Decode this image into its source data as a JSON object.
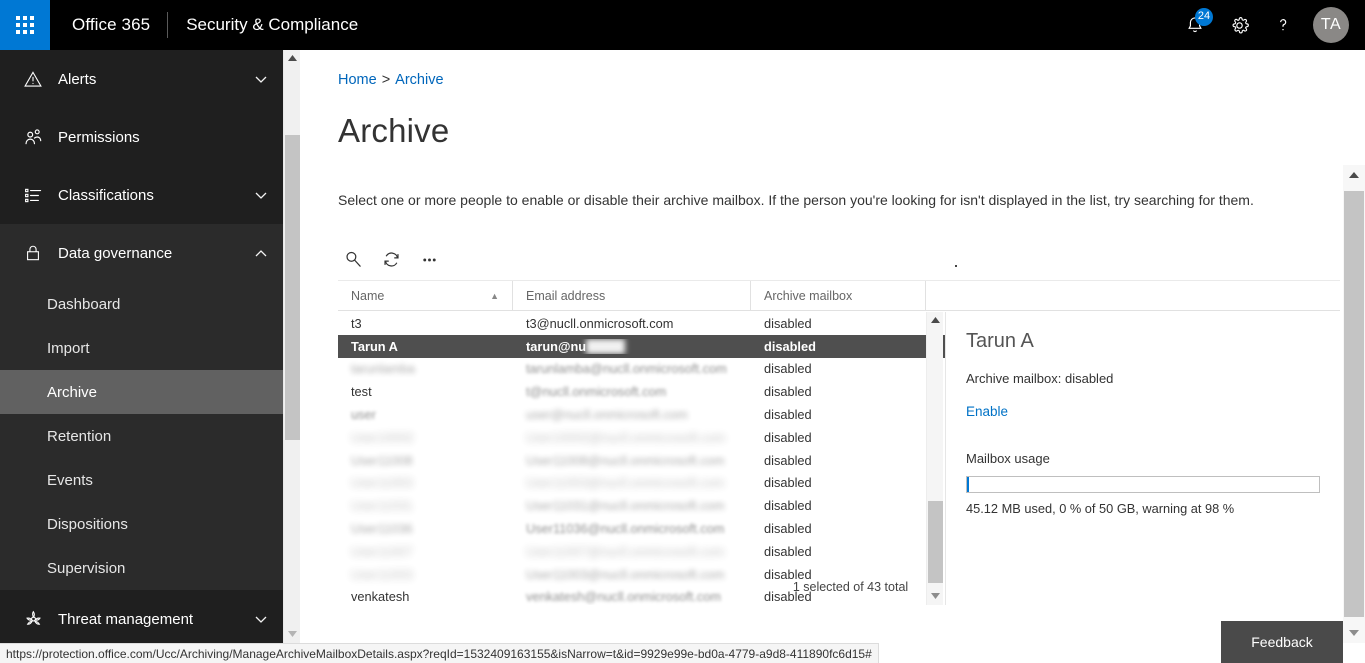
{
  "suitebar": {
    "waffle_label": "app-launcher",
    "brand": "Office 365",
    "app_name": "Security & Compliance",
    "notifications_count": "24",
    "notifications_icon": "bell-icon",
    "settings_icon": "gear-icon",
    "help_icon": "question-mark-icon",
    "avatar_initials": "TA"
  },
  "sidebar": {
    "items": [
      {
        "label": "Alerts",
        "icon": "warning-triangle-icon",
        "expandable": true,
        "expanded": false
      },
      {
        "label": "Permissions",
        "icon": "people-icon",
        "expandable": false,
        "expanded": false
      },
      {
        "label": "Classifications",
        "icon": "list-icon",
        "expandable": true,
        "expanded": false
      },
      {
        "label": "Data governance",
        "icon": "lock-icon",
        "expandable": true,
        "expanded": true
      },
      {
        "label": "Threat management",
        "icon": "biohazard-icon",
        "expandable": true,
        "expanded": false
      }
    ],
    "data_governance_children": [
      {
        "label": "Dashboard",
        "selected": false
      },
      {
        "label": "Import",
        "selected": false
      },
      {
        "label": "Archive",
        "selected": true
      },
      {
        "label": "Retention",
        "selected": false
      },
      {
        "label": "Events",
        "selected": false
      },
      {
        "label": "Dispositions",
        "selected": false
      },
      {
        "label": "Supervision",
        "selected": false
      }
    ]
  },
  "breadcrumb": {
    "home": "Home",
    "separator": ">",
    "current": "Archive"
  },
  "page": {
    "title": "Archive",
    "description": "Select one or more people to enable or disable their archive mailbox. If the person you're looking for isn't displayed in the list, try searching for them."
  },
  "toolbar": {
    "search_icon": "search-icon",
    "refresh_icon": "refresh-icon",
    "more_icon": "ellipsis-icon"
  },
  "table": {
    "columns": [
      "Name",
      "Email address",
      "Archive mailbox",
      ""
    ],
    "sort_column": "Name",
    "sort_direction": "ascending",
    "rows": [
      {
        "name": "t3",
        "email": "t3@nucll.onmicrosoft.com",
        "archive": "disabled",
        "selected": false,
        "blur": "none"
      },
      {
        "name": "Tarun A",
        "email": "tarun@nu",
        "archive": "disabled",
        "selected": true,
        "blur": "partial"
      },
      {
        "name": "tarunlamba",
        "email": "tarunlamba@nucll.onmicrosoft.com",
        "archive": "disabled",
        "selected": false,
        "blur": "light"
      },
      {
        "name": "test",
        "email": "t@nucll.onmicrosoft.com",
        "archive": "disabled",
        "selected": false,
        "blur": "light"
      },
      {
        "name": "user",
        "email": "user@nucll.onmicrosoft.com",
        "archive": "disabled",
        "selected": false,
        "blur": "light"
      },
      {
        "name": "User10002",
        "email": "User10002@nucll.onmicrosoft.com",
        "archive": "disabled",
        "selected": false,
        "blur": "heavy"
      },
      {
        "name": "User11008",
        "email": "User11008@nucll.onmicrosoft.com",
        "archive": "disabled",
        "selected": false,
        "blur": "medium"
      },
      {
        "name": "User11053",
        "email": "User11053@nucll.onmicrosoft.com",
        "archive": "disabled",
        "selected": false,
        "blur": "heavy"
      },
      {
        "name": "User11031",
        "email": "User11031@nucll.onmicrosoft.com",
        "archive": "disabled",
        "selected": false,
        "blur": "heavy"
      },
      {
        "name": "User11036",
        "email": "User11036@nucll.onmicrosoft.com",
        "archive": "disabled",
        "selected": false,
        "blur": "light"
      },
      {
        "name": "User11007",
        "email": "User11007@nucll.onmicrosoft.com",
        "archive": "disabled",
        "selected": false,
        "blur": "heavy"
      },
      {
        "name": "User11003",
        "email": "User11003@nucll.onmicrosoft.com",
        "archive": "disabled",
        "selected": false,
        "blur": "medium"
      },
      {
        "name": "venkatesh",
        "email": "venkatesh@nucll.onmicrosoft.com",
        "archive": "disabled",
        "selected": false,
        "blur": "none"
      }
    ],
    "footer_status": "1 selected of 43 total"
  },
  "detail": {
    "title": "Tarun A",
    "archive_status": "Archive mailbox: disabled",
    "action_link": "Enable",
    "usage_label": "Mailbox usage",
    "usage_text": "45.12 MB used, 0 % of 50 GB, warning at 98 %",
    "usage_percent": 0
  },
  "feedback": {
    "label": "Feedback"
  },
  "statusbar": {
    "url": "https://protection.office.com/Ucc/Archiving/ManageArchiveMailboxDetails.aspx?reqId=1532409163155&isNarrow=t&id=9929e99e-bd0a-4779-a9d8-411890fc6d15#"
  },
  "colors": {
    "brand_blue": "#0078d4",
    "link_blue": "#0072c6",
    "suitebar_black": "#000000",
    "nav_dark": "#1f1f1f",
    "nav_group": "#2b2b2b",
    "nav_selected": "#616161",
    "row_selected": "#4f4f4f",
    "feedback_gray": "#4a4a4a"
  }
}
